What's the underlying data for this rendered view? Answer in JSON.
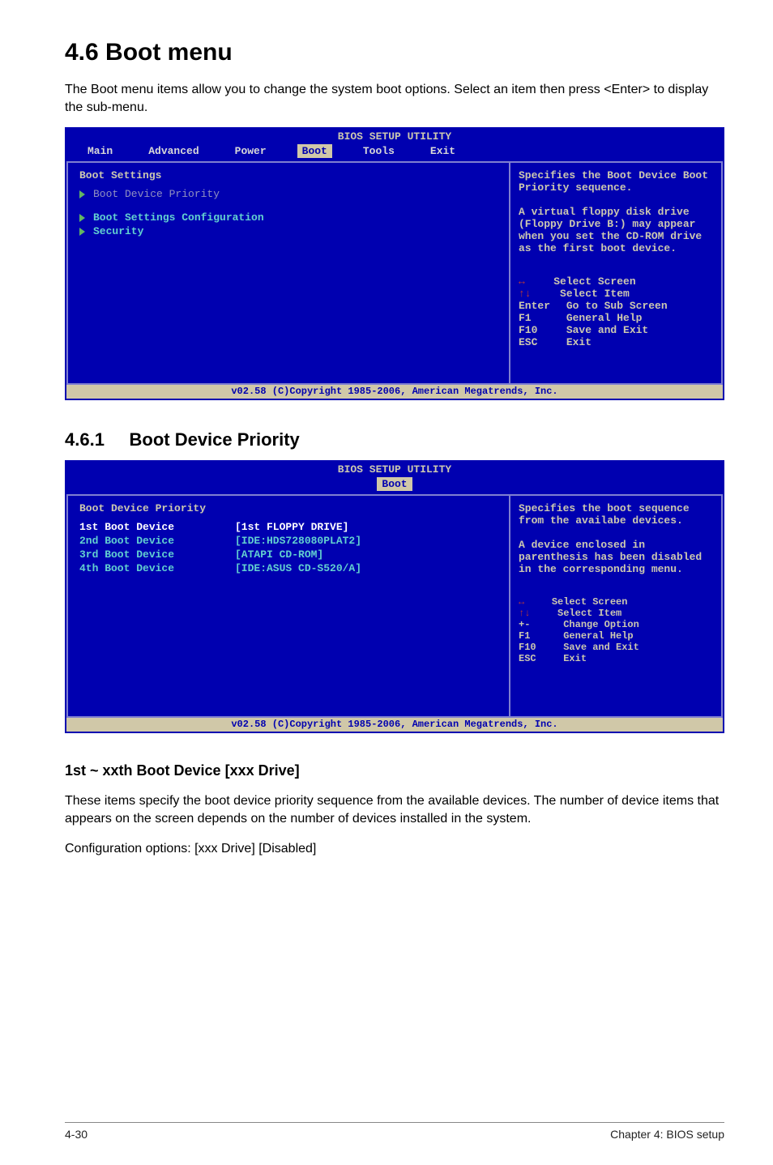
{
  "h1": "4.6     Boot menu",
  "intro": "The Boot menu items allow you to change the system boot options. Select an item then press <Enter> to display the sub-menu.",
  "bios1": {
    "title": "BIOS SETUP UTILITY",
    "tabs": [
      "Main",
      "Advanced",
      "Power",
      "Boot",
      "Tools",
      "Exit"
    ],
    "activeTab": "Boot",
    "heading": "Boot Settings",
    "items": [
      {
        "label": "Boot Device Priority",
        "style": "grey"
      },
      {
        "label": "Boot Settings Configuration",
        "style": "cyan"
      },
      {
        "label": "Security",
        "style": "cyan"
      }
    ],
    "help": "Specifies the Boot Device Boot Priority sequence.\n\nA virtual floppy disk drive (Floppy Drive B:) may appear when you set the CD-ROM drive as the first boot device.",
    "keys": [
      {
        "k": "↔",
        "t": "Select Screen",
        "arrow": true
      },
      {
        "k": "↑↓",
        "t": "Select Item",
        "arrow": true
      },
      {
        "k": "Enter",
        "t": "Go to Sub Screen"
      },
      {
        "k": "F1",
        "t": "General Help"
      },
      {
        "k": "F10",
        "t": "Save and Exit"
      },
      {
        "k": "ESC",
        "t": "Exit"
      }
    ],
    "footer": "v02.58 (C)Copyright 1985-2006, American Megatrends, Inc."
  },
  "sub1_num": "4.6.1",
  "sub1_title": "Boot Device Priority",
  "bios2": {
    "title": "BIOS SETUP UTILITY",
    "tabs": [
      "Boot"
    ],
    "activeTab": "Boot",
    "heading": "Boot Device Priority",
    "rows": [
      {
        "k": "1st Boot Device",
        "v": "[1st FLOPPY DRIVE]",
        "sel": true
      },
      {
        "k": "2nd Boot Device",
        "v": "[IDE:HDS728080PLAT2]"
      },
      {
        "k": "3rd Boot Device",
        "v": "[ATAPI CD-ROM]"
      },
      {
        "k": "4th Boot Device",
        "v": "[IDE:ASUS CD-S520/A]"
      }
    ],
    "help": "Specifies the boot sequence from the availabe devices.\n\nA device enclosed in parenthesis has been disabled in the corresponding menu.",
    "keys": [
      {
        "k": "↔",
        "t": "Select Screen",
        "arrow": true
      },
      {
        "k": "↑↓",
        "t": "Select Item",
        "arrow": true
      },
      {
        "k": "+-",
        "t": "Change Option"
      },
      {
        "k": "F1",
        "t": "General Help"
      },
      {
        "k": "F10",
        "t": "Save and Exit"
      },
      {
        "k": "ESC",
        "t": "Exit"
      }
    ],
    "footer": "v02.58 (C)Copyright 1985-2006, American Megatrends, Inc."
  },
  "opt_heading": "1st ~ xxth Boot Device [xxx Drive]",
  "opt_text1": "These items specify the boot device priority sequence from the available devices. The number of device items that appears on the screen depends on the number of devices installed in the system.",
  "opt_text2": "Configuration options: [xxx Drive] [Disabled]",
  "pgnum": "4-30",
  "chap": "Chapter 4: BIOS setup"
}
